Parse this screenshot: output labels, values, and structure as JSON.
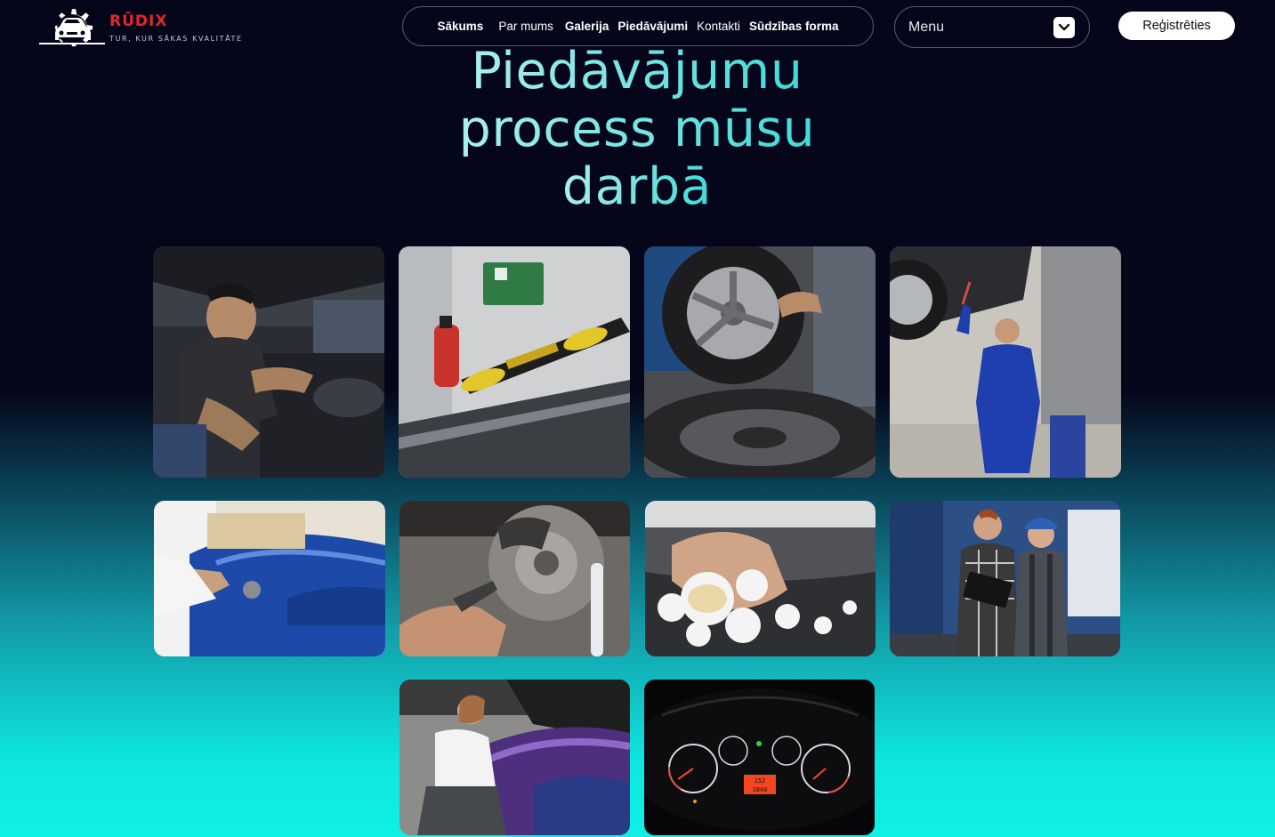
{
  "header": {
    "brand": "RŪDIX",
    "tagline": "TUR, KUR SĀKAS KVALITĀTE",
    "nav": [
      "Sākums",
      "Par mums",
      "Galerija",
      "Piedāvājumi",
      "Kontakti",
      "Sūdzības forma"
    ],
    "menu_label": "Menu",
    "register_label": "Reģistrēties"
  },
  "title_lines": [
    "Piedāvājumu",
    "process mūsu",
    "darbā"
  ],
  "gallery": {
    "items": [
      {
        "icon": "mechanic-engine-photo"
      },
      {
        "icon": "windshield-repair-photo"
      },
      {
        "icon": "tire-change-photo"
      },
      {
        "icon": "mechanic-inspection-photo"
      },
      {
        "icon": "car-painting-photo"
      },
      {
        "icon": "brake-disc-photo"
      },
      {
        "icon": "car-wash-photo"
      },
      {
        "icon": "mechanics-clipboard-photo"
      },
      {
        "icon": "car-wrap-photo"
      },
      {
        "icon": "dashboard-gauges-photo"
      }
    ]
  },
  "dashboard_readout": {
    "odometer_top": "152",
    "odometer_bottom": "1840"
  },
  "colors": {
    "background_top": "#05061a",
    "background_bottom": "#0ff0e4",
    "brand_red": "#e3262b",
    "title_cyan": "#3fdad8"
  }
}
